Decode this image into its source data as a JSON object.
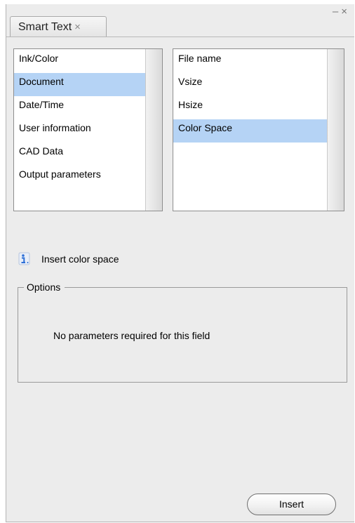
{
  "window": {
    "minimize_glyph": "–",
    "close_glyph": "×"
  },
  "tab": {
    "label": "Smart Text",
    "close_glyph": "×"
  },
  "categories": {
    "items": [
      {
        "label": "Ink/Color"
      },
      {
        "label": "Document",
        "selected": true
      },
      {
        "label": "Date/Time"
      },
      {
        "label": "User information"
      },
      {
        "label": "CAD Data"
      },
      {
        "label": "Output parameters"
      }
    ]
  },
  "fields": {
    "items": [
      {
        "label": "File name"
      },
      {
        "label": "Vsize"
      },
      {
        "label": "Hsize"
      },
      {
        "label": "Color Space",
        "selected": true
      }
    ]
  },
  "info": {
    "icon": "info-icon",
    "text": "Insert color space"
  },
  "options": {
    "legend": "Options",
    "message": "No parameters required for this field"
  },
  "actions": {
    "insert_label": "Insert"
  },
  "colors": {
    "selection": "#b5d3f5",
    "panel_bg": "#ececec",
    "info_icon_blue": "#2d6fd6"
  }
}
